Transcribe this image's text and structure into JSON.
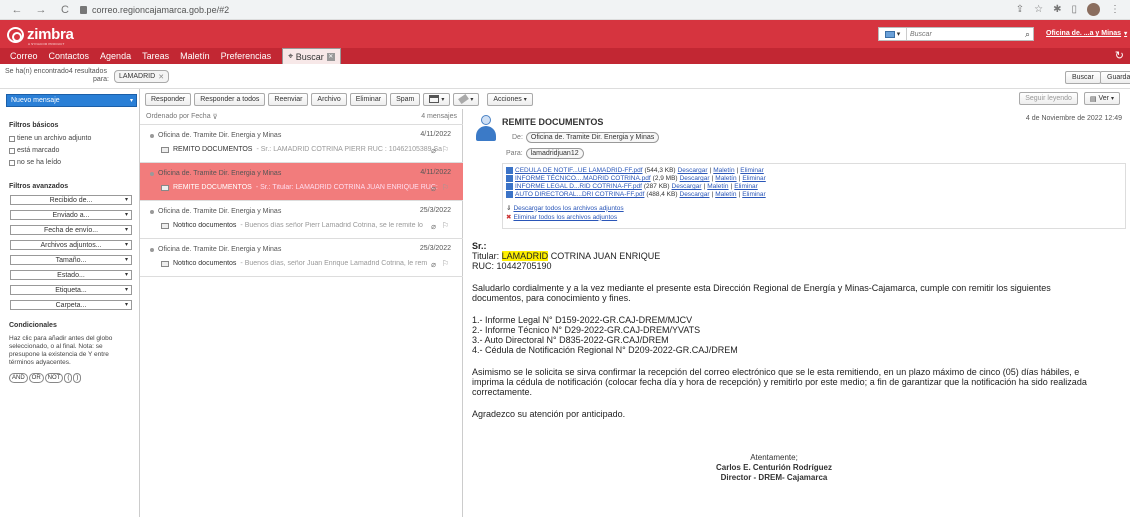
{
  "browser": {
    "url": "correo.regioncajamarca.gob.pe/#2",
    "back": "←",
    "forward": "→",
    "reload": "C"
  },
  "brand": {
    "logo": "zimbra",
    "logo_tag": "A SYNACOR PRODUCT"
  },
  "topsearch": {
    "placeholder": "Buscar"
  },
  "user": {
    "name": "Oficina de. ...a y Minas"
  },
  "nav": {
    "tabs": [
      "Correo",
      "Contactos",
      "Agenda",
      "Tareas",
      "Maletín",
      "Preferencias"
    ],
    "search_tab": "Buscar"
  },
  "search": {
    "result_text": "Se ha(n) encontrado4 resultados",
    "para": "para:",
    "chip": "LAMADRID",
    "buscar": "Buscar",
    "guardar": "Guardar"
  },
  "sidebar": {
    "new_message": "Nuevo mensaje",
    "basic_title": "Filtros básicos",
    "basic": [
      "tiene un archivo adjunto",
      "está marcado",
      "no se ha leído"
    ],
    "adv_title": "Filtros avanzados",
    "advanced": [
      "Recibido de...",
      "Enviado a...",
      "Fecha de envío...",
      "Archivos adjuntos...",
      "Tamaño...",
      "Estado...",
      "Etiqueta...",
      "Carpeta..."
    ],
    "cond_title": "Condicionales",
    "cond_text": "Haz clic para añadir antes del globo seleccionado, o al final. Nota: se presupone la existencia de Y entre términos adyacentes.",
    "ops": [
      "AND",
      "OR",
      "NOT",
      "(",
      ")"
    ]
  },
  "toolbar": {
    "responder": "Responder",
    "responder_todos": "Responder a todos",
    "reenviar": "Reenviar",
    "archivo": "Archivo",
    "eliminar": "Eliminar",
    "spam": "Spam",
    "acciones": "Acciones",
    "seguir_leyendo": "Seguir leyendo",
    "ver": "Ver"
  },
  "list": {
    "sort": "Ordenado por Fecha",
    "count": "4 mensajes",
    "items": [
      {
        "from": "Oficina de. Tramite Dir. Energia y Minas",
        "date": "4/11/2022",
        "subject": "REMITO DOCUMENTOS",
        "fragment": " - Sr.: LAMADRID COTRINA PIERR RUC : 10462105389 Sa"
      },
      {
        "from": "Oficina de. Tramite Dir. Energia y Minas",
        "date": "4/11/2022",
        "subject": "REMITE DOCUMENTOS",
        "fragment": " - Sr.: Titular: LAMADRID COTRINA JUAN ENRIQUE RUC:"
      },
      {
        "from": "Oficina de. Tramite Dir. Energia y Minas",
        "date": "25/3/2022",
        "subject": "Notifico documentos",
        "fragment": " - Buenos días señor Pierr Lamadrid Cotrina, se le remite lo"
      },
      {
        "from": "Oficina de. Tramite Dir. Energia y Minas",
        "date": "25/3/2022",
        "subject": "Notifico documentos",
        "fragment": " - Buenos días, señor Juan Enrique Lamadrid Cotrina, le rem"
      }
    ]
  },
  "message": {
    "title": "REMITE DOCUMENTOS",
    "date": "4 de Noviembre de 2022 12:49",
    "de_label": "De:",
    "de": "Oficina de. Tramite Dir. Energia y Minas",
    "para_label": "Para:",
    "para": "lamadridjuan12",
    "attachments": [
      {
        "name": "CEDULA DE NOTIF...UE LAMADRID-FF.pdf",
        "size": "(544,3 KB)"
      },
      {
        "name": "INFORME TÉCNICO....MADRID COTRINA.pdf",
        "size": "(2,9 MB)"
      },
      {
        "name": "INFORME LEGAL D...RID COTRINA-FF.pdf",
        "size": "(287 KB)"
      },
      {
        "name": "AUTO DIRECTORAL...DRI COTRINA-FF.pdf",
        "size": "(488,4 KB)"
      }
    ],
    "att_links": {
      "descargar": "Descargar",
      "maletin": "Maletín",
      "eliminar": "Eliminar",
      "sep": "|"
    },
    "download_all": "Descargar todos los archivos adjuntos",
    "delete_all": "Eliminar todos los archivos adjuntos",
    "body": {
      "sr": "Sr.:",
      "titular_pre": "Titular: ",
      "titular_hl": "LAMADRID",
      "titular_post": " COTRINA JUAN ENRIQUE",
      "ruc": "RUC: 10442705190",
      "p1a": "Saludarlo cordialmente y a la vez mediante el presente esta Dirección Regional de Energía y Minas-Cajamarca, cumple con remitir los siguientes",
      "p1b": "documentos, para conocimiento y fines.",
      "l1": "1.- Informe Legal N° D159-2022-GR.CAJ-DREM/MJCV",
      "l2": "2.- Informe Técnico N° D29-2022-GR.CAJ-DREM/YVATS",
      "l3": "3.- Auto Directoral N° D835-2022-GR.CAJ/DREM",
      "l4": "4.- Cédula de Notificación Regional N° D209-2022-GR.CAJ/DREM",
      "p2a": "Asimismo se le solicita se sirva confirmar la recepción del correo electrónico que se le esta remitiendo, en un plazo máximo de cinco (05) días hábiles, e",
      "p2b": "imprima la cédula de notificación (colocar fecha día y hora de recepción) y remitirlo por este medio; a fin de garantizar que la notificación ha sido realizada",
      "p2c": "correctamente.",
      "p3": "Agradezco su atención por anticipado.",
      "sig1": "Atentamente;",
      "sig2": "Carlos E. Centurión Rodríguez",
      "sig3": "Director - DREM- Cajamarca"
    }
  }
}
